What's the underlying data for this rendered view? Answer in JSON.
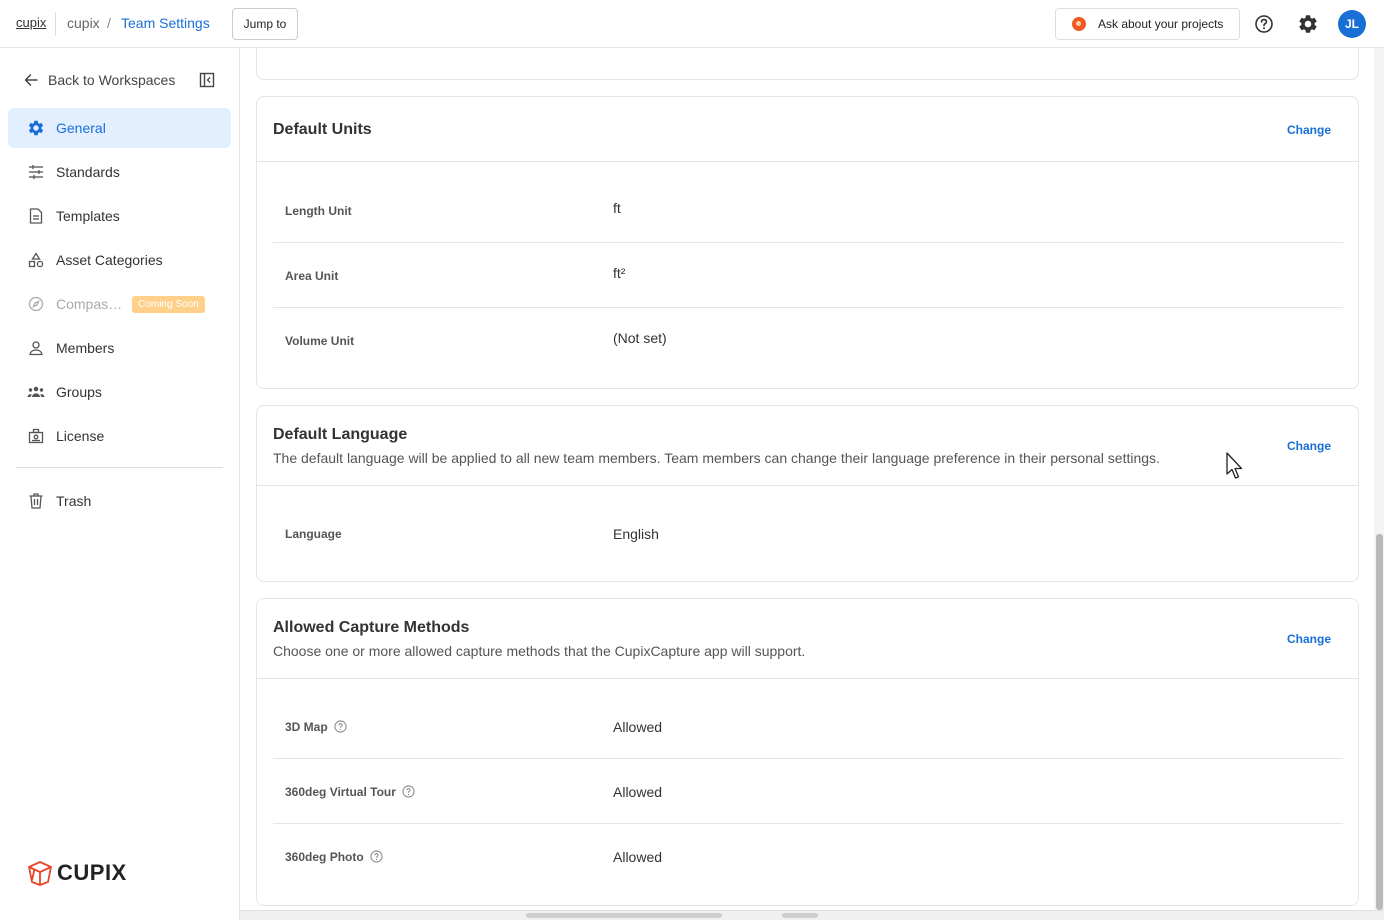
{
  "topbar": {
    "logo_text": "cupix",
    "breadcrumb": [
      "cupix",
      "Team Settings"
    ],
    "breadcrumb_separator": "/",
    "jump_label": "Jump to",
    "ask_label": "Ask about your projects",
    "avatar_initials": "JL"
  },
  "sidebar": {
    "back_label": "Back to Workspaces",
    "items": [
      {
        "label": "General",
        "icon": "gear-icon",
        "active": true
      },
      {
        "label": "Standards",
        "icon": "sliders-icon"
      },
      {
        "label": "Templates",
        "icon": "document-icon"
      },
      {
        "label": "Asset Categories",
        "icon": "shapes-icon"
      },
      {
        "label": "Compas…",
        "icon": "compass-icon",
        "badge": "Coming Soon",
        "disabled": true
      },
      {
        "label": "Members",
        "icon": "person-icon"
      },
      {
        "label": "Groups",
        "icon": "group-icon"
      },
      {
        "label": "License",
        "icon": "license-icon"
      },
      {
        "label": "Trash",
        "icon": "trash-icon"
      }
    ],
    "brand_text": "CUPIX"
  },
  "sections": {
    "units": {
      "title": "Default Units",
      "change_label": "Change",
      "rows": [
        {
          "label": "Length Unit",
          "value": "ft"
        },
        {
          "label": "Area Unit",
          "value": "ft²"
        },
        {
          "label": "Volume Unit",
          "value": "(Not set)"
        }
      ]
    },
    "language": {
      "title": "Default Language",
      "description": "The default language will be applied to all new team members. Team members can change their language preference in their personal settings.",
      "change_label": "Change",
      "rows": [
        {
          "label": "Language",
          "value": "English"
        }
      ]
    },
    "capture": {
      "title": "Allowed Capture Methods",
      "description": "Choose one or more allowed capture methods that the CupixCapture app will support.",
      "change_label": "Change",
      "rows": [
        {
          "label": "3D Map",
          "value": "Allowed"
        },
        {
          "label": "360deg Virtual Tour",
          "value": "Allowed"
        },
        {
          "label": "360deg Photo",
          "value": "Allowed"
        }
      ]
    }
  },
  "colors": {
    "accent": "#1a6fd6",
    "active_bg": "#e3efff",
    "badge": "#ffd08a",
    "brand_red": "#e8452c"
  }
}
